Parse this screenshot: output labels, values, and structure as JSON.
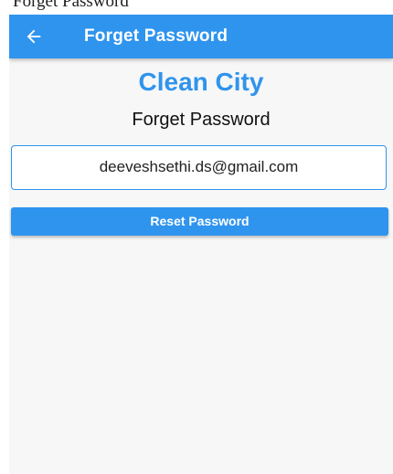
{
  "caption": "Forget Password",
  "app_bar": {
    "title": "Forget Password",
    "back_icon": "arrow-back-icon"
  },
  "brand": {
    "title": "Clean City"
  },
  "screen": {
    "heading": "Forget Password"
  },
  "form": {
    "email_value": "deeveshsethi.ds@gmail.com",
    "reset_label": "Reset Password"
  },
  "colors": {
    "primary": "#2f94ee",
    "background": "#f7f7f7",
    "text": "#111111"
  }
}
